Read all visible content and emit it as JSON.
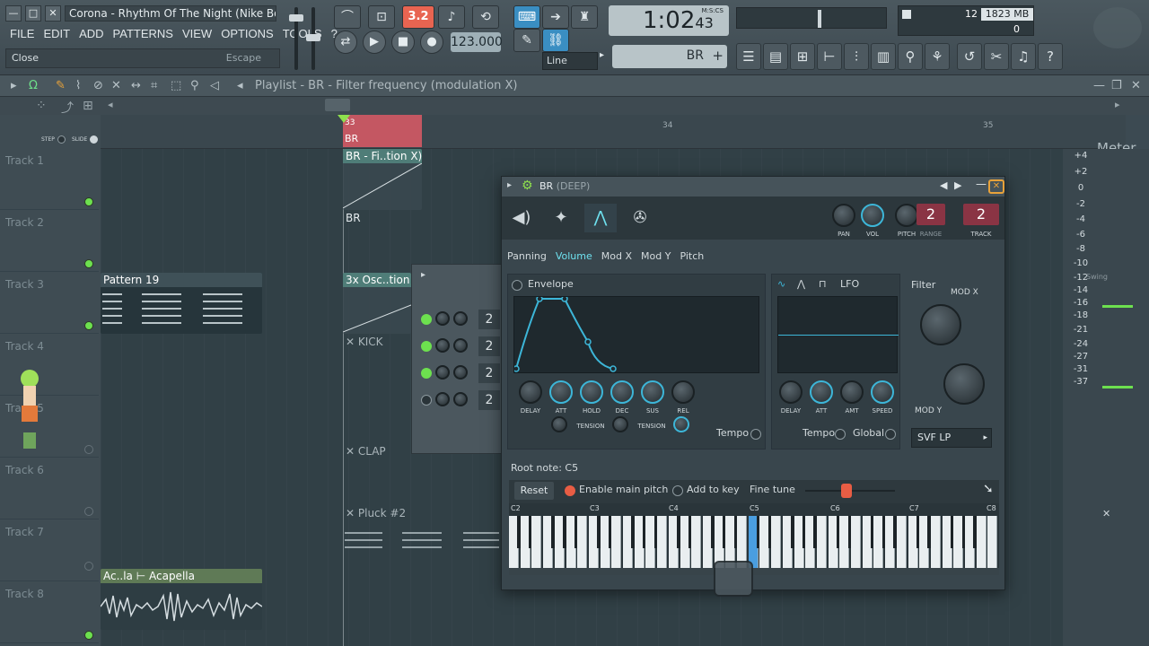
{
  "window": {
    "title": "Corona - Rhythm Of The Night (Nike Boy)..",
    "minimize": "—",
    "maximize": "□",
    "close": "✕"
  },
  "menu": [
    "FILE",
    "EDIT",
    "ADD",
    "PATTERNS",
    "VIEW",
    "OPTIONS",
    "TOOLS",
    "?"
  ],
  "hint": {
    "left": "Close",
    "right": "Escape"
  },
  "transport": {
    "pattern_number": "3.2",
    "tempo": "123.000",
    "time_main": "1:02",
    "time_sub": "43",
    "time_unit": "M:S:CS",
    "snap": "Line",
    "pattern_name": "BR"
  },
  "monitor": {
    "cpu": "12",
    "memory": "1823 MB",
    "polyphony": "0"
  },
  "playlist": {
    "title": "Playlist - BR - Filter frequency (modulation X)",
    "step_label": "STEP",
    "slide_label": "SLIDE",
    "ruler": [
      "33",
      "34",
      "35"
    ],
    "marker": "BR",
    "meter_title": "Meter",
    "meter_labels": [
      "+4",
      "+2",
      "0",
      "-2",
      "-4",
      "-6",
      "-8",
      "-10",
      "-12",
      "-14",
      "-16",
      "-18",
      "-21",
      "-24",
      "-27",
      "-31",
      "-37"
    ],
    "tracks": [
      "Track 1",
      "Track 2",
      "Track 3",
      "Track 4",
      "Track 5",
      "Track 6",
      "Track 7",
      "Track 8"
    ],
    "clips": {
      "br_filter": "BR - Fi..tion X)",
      "br": "BR",
      "pattern19": "Pattern 19",
      "osc": "3x Osc..tion",
      "kick": "KICK",
      "clap": "CLAP",
      "pluck": "Pluck #2",
      "acapella": "Ac..la ⊢ Acapella"
    },
    "channel_values": [
      "2",
      "2",
      "2",
      "2"
    ],
    "swing_label": "Swing"
  },
  "plugin": {
    "title": "BR",
    "subtitle": "(DEEP)",
    "pan_label": "PAN",
    "vol_label": "VOL",
    "pitch_label": "PITCH",
    "range_label": "RANGE",
    "range_value": "2",
    "track_label": "TRACK",
    "track_value": "2",
    "tabs": [
      "Panning",
      "Volume",
      "Mod X",
      "Mod Y",
      "Pitch"
    ],
    "envelope_label": "Envelope",
    "env_knobs": [
      "DELAY",
      "ATT",
      "HOLD",
      "DEC",
      "SUS",
      "REL"
    ],
    "tension_label": "TENSION",
    "tempo_label": "Tempo",
    "lfo_label": "LFO",
    "lfo_knobs": [
      "DELAY",
      "ATT",
      "AMT",
      "SPEED"
    ],
    "global_label": "Global",
    "filter_label": "Filter",
    "modx_label": "MOD X",
    "mody_label": "MOD Y",
    "filter_type": "SVF LP",
    "root_note": "Root note: C5",
    "reset_label": "Reset",
    "enable_pitch": "Enable main pitch",
    "add_to_key": "Add to key",
    "fine_tune": "Fine tune",
    "octaves": [
      "C2",
      "C3",
      "C4",
      "C5",
      "C6",
      "C7",
      "C8"
    ]
  }
}
